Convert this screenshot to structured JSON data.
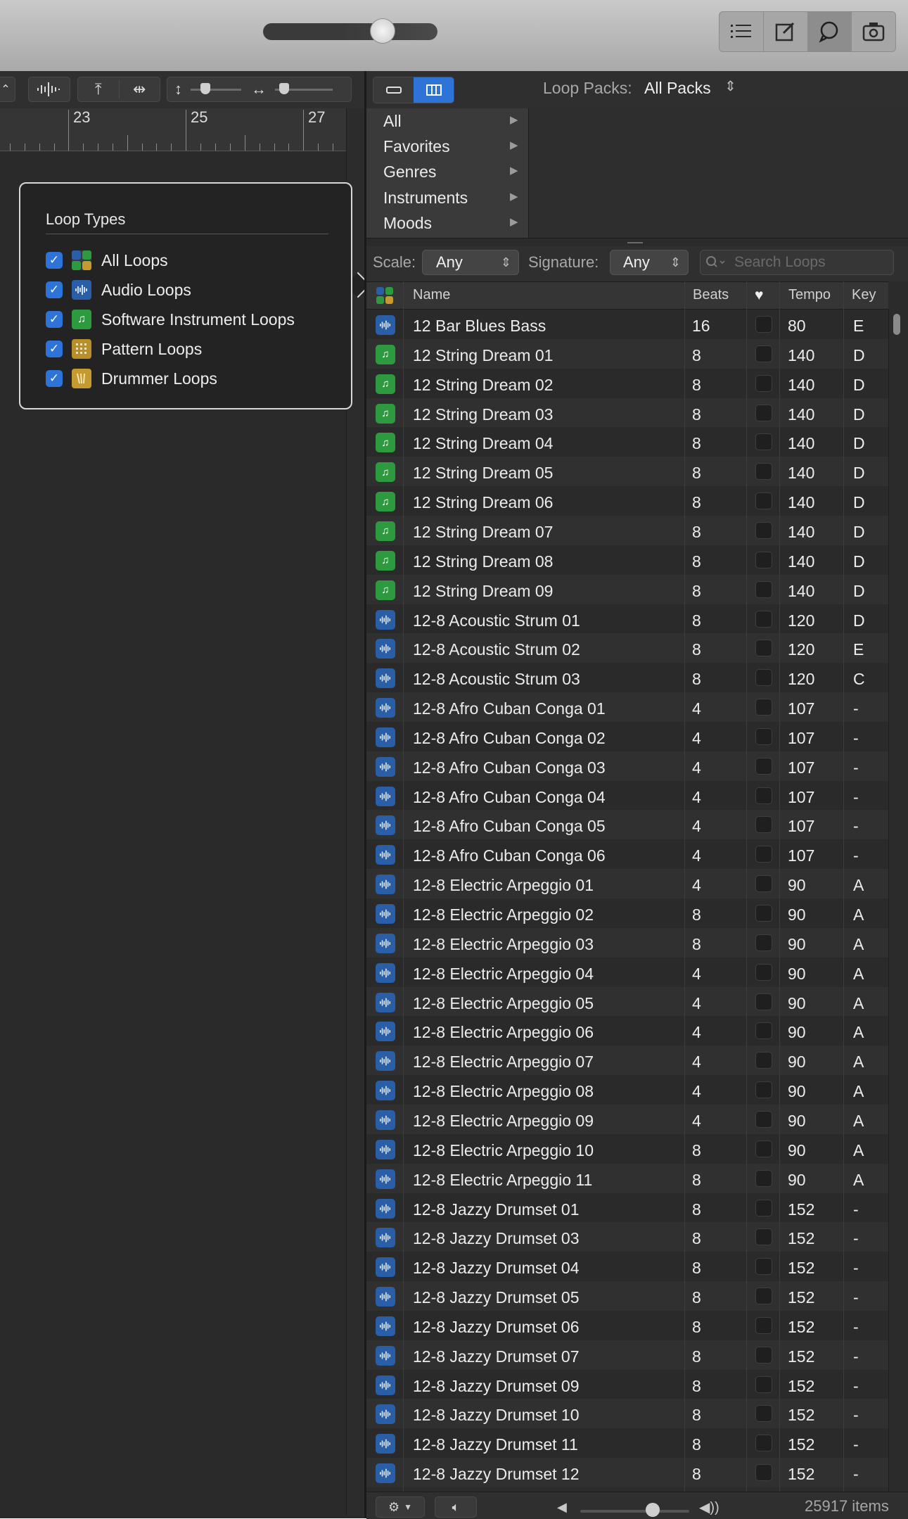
{
  "loop_packs": {
    "label": "Loop Packs:",
    "value": "All Packs"
  },
  "categories": [
    "All",
    "Favorites",
    "Genres",
    "Instruments",
    "Moods"
  ],
  "ruler": [
    "23",
    "25",
    "27"
  ],
  "popover": {
    "title": "Loop Types",
    "items": [
      {
        "label": "All Loops",
        "type": "all"
      },
      {
        "label": "Audio Loops",
        "type": "audio"
      },
      {
        "label": "Software Instrument Loops",
        "type": "software"
      },
      {
        "label": "Pattern Loops",
        "type": "pattern"
      },
      {
        "label": "Drummer Loops",
        "type": "drummer"
      }
    ]
  },
  "filters": {
    "scale_label": "Scale:",
    "scale_value": "Any",
    "signature_label": "Signature:",
    "signature_value": "Any",
    "search_placeholder": "Search Loops"
  },
  "columns": {
    "name": "Name",
    "beats": "Beats",
    "tempo": "Tempo",
    "key": "Key"
  },
  "colors": {
    "audio": "#2a5fa8",
    "software": "#2e9a3f",
    "pattern": "#b8902a",
    "drummer": "#c59a2e",
    "accent": "#2d73d8"
  },
  "rows": [
    {
      "name": "12 Bar Blues Bass",
      "beats": "16",
      "tempo": "80",
      "key": "E",
      "type": "audio"
    },
    {
      "name": "12 String Dream 01",
      "beats": "8",
      "tempo": "140",
      "key": "D",
      "type": "software"
    },
    {
      "name": "12 String Dream 02",
      "beats": "8",
      "tempo": "140",
      "key": "D",
      "type": "software"
    },
    {
      "name": "12 String Dream 03",
      "beats": "8",
      "tempo": "140",
      "key": "D",
      "type": "software"
    },
    {
      "name": "12 String Dream 04",
      "beats": "8",
      "tempo": "140",
      "key": "D",
      "type": "software"
    },
    {
      "name": "12 String Dream 05",
      "beats": "8",
      "tempo": "140",
      "key": "D",
      "type": "software"
    },
    {
      "name": "12 String Dream 06",
      "beats": "8",
      "tempo": "140",
      "key": "D",
      "type": "software"
    },
    {
      "name": "12 String Dream 07",
      "beats": "8",
      "tempo": "140",
      "key": "D",
      "type": "software"
    },
    {
      "name": "12 String Dream 08",
      "beats": "8",
      "tempo": "140",
      "key": "D",
      "type": "software"
    },
    {
      "name": "12 String Dream 09",
      "beats": "8",
      "tempo": "140",
      "key": "D",
      "type": "software"
    },
    {
      "name": "12-8 Acoustic Strum 01",
      "beats": "8",
      "tempo": "120",
      "key": "D",
      "type": "audio"
    },
    {
      "name": "12-8 Acoustic Strum 02",
      "beats": "8",
      "tempo": "120",
      "key": "E",
      "type": "audio"
    },
    {
      "name": "12-8 Acoustic Strum 03",
      "beats": "8",
      "tempo": "120",
      "key": "C",
      "type": "audio"
    },
    {
      "name": "12-8 Afro Cuban Conga 01",
      "beats": "4",
      "tempo": "107",
      "key": "-",
      "type": "audio"
    },
    {
      "name": "12-8 Afro Cuban Conga 02",
      "beats": "4",
      "tempo": "107",
      "key": "-",
      "type": "audio"
    },
    {
      "name": "12-8 Afro Cuban Conga 03",
      "beats": "4",
      "tempo": "107",
      "key": "-",
      "type": "audio"
    },
    {
      "name": "12-8 Afro Cuban Conga 04",
      "beats": "4",
      "tempo": "107",
      "key": "-",
      "type": "audio"
    },
    {
      "name": "12-8 Afro Cuban Conga 05",
      "beats": "4",
      "tempo": "107",
      "key": "-",
      "type": "audio"
    },
    {
      "name": "12-8 Afro Cuban Conga 06",
      "beats": "4",
      "tempo": "107",
      "key": "-",
      "type": "audio"
    },
    {
      "name": "12-8 Electric Arpeggio 01",
      "beats": "4",
      "tempo": "90",
      "key": "A",
      "type": "audio"
    },
    {
      "name": "12-8 Electric Arpeggio 02",
      "beats": "8",
      "tempo": "90",
      "key": "A",
      "type": "audio"
    },
    {
      "name": "12-8 Electric Arpeggio 03",
      "beats": "8",
      "tempo": "90",
      "key": "A",
      "type": "audio"
    },
    {
      "name": "12-8 Electric Arpeggio 04",
      "beats": "4",
      "tempo": "90",
      "key": "A",
      "type": "audio"
    },
    {
      "name": "12-8 Electric Arpeggio 05",
      "beats": "4",
      "tempo": "90",
      "key": "A",
      "type": "audio"
    },
    {
      "name": "12-8 Electric Arpeggio 06",
      "beats": "4",
      "tempo": "90",
      "key": "A",
      "type": "audio"
    },
    {
      "name": "12-8 Electric Arpeggio 07",
      "beats": "4",
      "tempo": "90",
      "key": "A",
      "type": "audio"
    },
    {
      "name": "12-8 Electric Arpeggio 08",
      "beats": "4",
      "tempo": "90",
      "key": "A",
      "type": "audio"
    },
    {
      "name": "12-8 Electric Arpeggio 09",
      "beats": "4",
      "tempo": "90",
      "key": "A",
      "type": "audio"
    },
    {
      "name": "12-8 Electric Arpeggio 10",
      "beats": "8",
      "tempo": "90",
      "key": "A",
      "type": "audio"
    },
    {
      "name": "12-8 Electric Arpeggio 11",
      "beats": "8",
      "tempo": "90",
      "key": "A",
      "type": "audio"
    },
    {
      "name": "12-8 Jazzy Drumset 01",
      "beats": "8",
      "tempo": "152",
      "key": "-",
      "type": "audio"
    },
    {
      "name": "12-8 Jazzy Drumset 03",
      "beats": "8",
      "tempo": "152",
      "key": "-",
      "type": "audio"
    },
    {
      "name": "12-8 Jazzy Drumset 04",
      "beats": "8",
      "tempo": "152",
      "key": "-",
      "type": "audio"
    },
    {
      "name": "12-8 Jazzy Drumset 05",
      "beats": "8",
      "tempo": "152",
      "key": "-",
      "type": "audio"
    },
    {
      "name": "12-8 Jazzy Drumset 06",
      "beats": "8",
      "tempo": "152",
      "key": "-",
      "type": "audio"
    },
    {
      "name": "12-8 Jazzy Drumset 07",
      "beats": "8",
      "tempo": "152",
      "key": "-",
      "type": "audio"
    },
    {
      "name": "12-8 Jazzy Drumset 09",
      "beats": "8",
      "tempo": "152",
      "key": "-",
      "type": "audio"
    },
    {
      "name": "12-8 Jazzy Drumset 10",
      "beats": "8",
      "tempo": "152",
      "key": "-",
      "type": "audio"
    },
    {
      "name": "12-8 Jazzy Drumset 11",
      "beats": "8",
      "tempo": "152",
      "key": "-",
      "type": "audio"
    },
    {
      "name": "12-8 Jazzy Drumset 12",
      "beats": "8",
      "tempo": "152",
      "key": "-",
      "type": "audio"
    }
  ],
  "footer": {
    "items_count": "25917 items"
  }
}
